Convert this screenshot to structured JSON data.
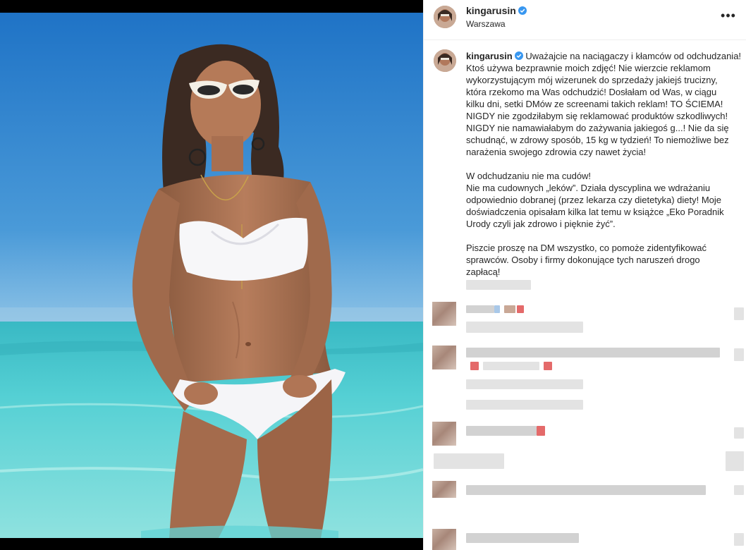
{
  "post": {
    "username": "kingarusin",
    "location": "Warszawa",
    "more_icon": "•••",
    "caption_lines": [
      "Uważajcie na naciągaczy i kłamców od odchudzania!",
      "Ktoś używa bezprawnie moich zdjęć! Nie wierzcie reklamom",
      "wykorzystującym mój wizerunek do sprzedaży jakiejś trucizny,",
      "która rzekomo ma Was odchudzić! Dosłałam od Was, w ciągu",
      "kilku dni, setki DMów ze screenami takich reklam! TO ŚCIEMA!",
      "NIGDY nie zgodziłabym się reklamować produktów szkodliwych!",
      "NIGDY nie namawiałabym do zażywania jakiegoś g...! Nie da się",
      "schudnąć, w zdrowy sposób, 15 kg w tydzień! To niemożliwe bez",
      "narażenia swojego zdrowia czy nawet życia!",
      "",
      "W odchudzaniu nie ma cudów!",
      "Nie ma cudownych „leków”. Działa dyscyplina we wdrażaniu",
      "odpowiednio dobranej (przez lekarza czy dietetyka) diety! Moje",
      "doświadczenia opisałam kilka lat temu w książce „Eko Poradnik",
      "Urody czyli jak zdrowo i pięknie żyć”.",
      "",
      "Piszcie proszę na DM wszystko, co pomoże zidentyfikować",
      "sprawców. Osoby i firmy dokonujące tych naruszeń drogo",
      "zapłacą!"
    ]
  },
  "icons": {
    "verified": "verified-badge-icon",
    "more": "more-options-icon"
  },
  "colors": {
    "verified_blue": "#3897f0",
    "text": "#262626",
    "sea": "#49c8d2",
    "sky": "#2f86d1"
  }
}
